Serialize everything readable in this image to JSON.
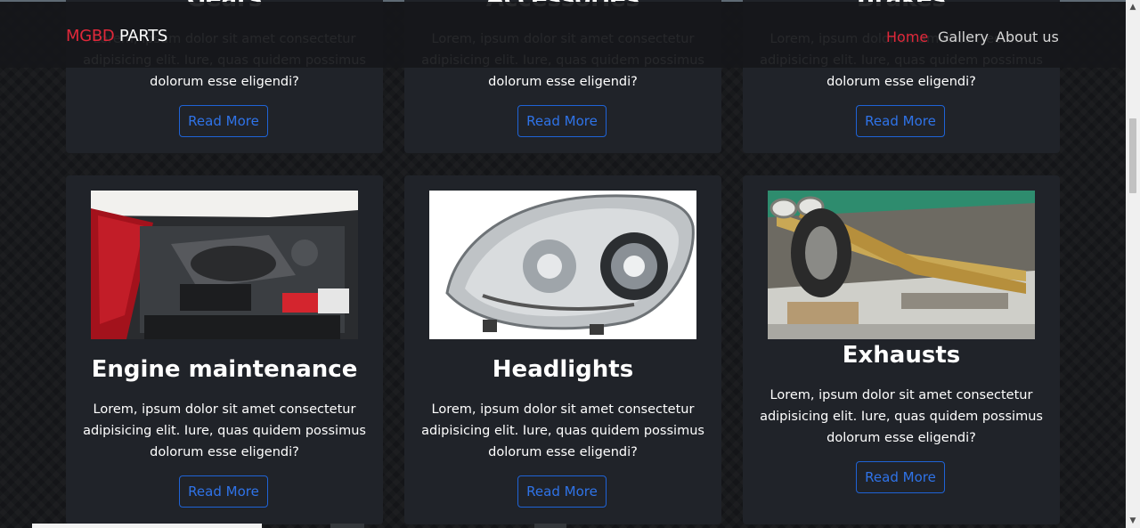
{
  "navbar": {
    "brand_red": "MGBD",
    "brand_white": "PARTS",
    "links": [
      "Home",
      "Gallery",
      "About us"
    ],
    "active": "Home"
  },
  "top_cards": [
    {
      "title": "Gears",
      "text": "Lorem, ipsum dolor sit amet consectetur adipisicing elit. Iure, quas quidem possimus dolorum esse eligendi?",
      "button": "Read More"
    },
    {
      "title": "Accessories",
      "text": "Lorem, ipsum dolor sit amet consectetur adipisicing elit. Iure, quas quidem possimus dolorum esse eligendi?",
      "button": "Read More"
    },
    {
      "title": "Brakes",
      "text": "Lorem, ipsum dolor sit amet consectetur adipisicing elit. Iure, quas quidem possimus dolorum esse eligendi?",
      "button": "Read More"
    }
  ],
  "cards": [
    {
      "title": "Engine maintenance",
      "image": "engine-bay-photo",
      "text": "Lorem, ipsum dolor sit amet consectetur adipisicing elit. Iure, quas quidem possimus dolorum esse eligendi?",
      "button": "Read More"
    },
    {
      "title": "Headlights",
      "image": "headlight-photo",
      "text": "Lorem, ipsum dolor sit amet consectetur adipisicing elit. Iure, quas quidem possimus dolorum esse eligendi?",
      "button": "Read More"
    },
    {
      "title": "Exhausts",
      "image": "exhaust-pipes-photo",
      "text": "Lorem, ipsum dolor sit amet consectetur adipisicing elit. Iure, quas quidem possimus dolorum esse eligendi?",
      "button": "Read More"
    }
  ],
  "colors": {
    "brand_red": "#e0283a",
    "button_blue": "#1f63d6",
    "card_bg": "#202329"
  }
}
